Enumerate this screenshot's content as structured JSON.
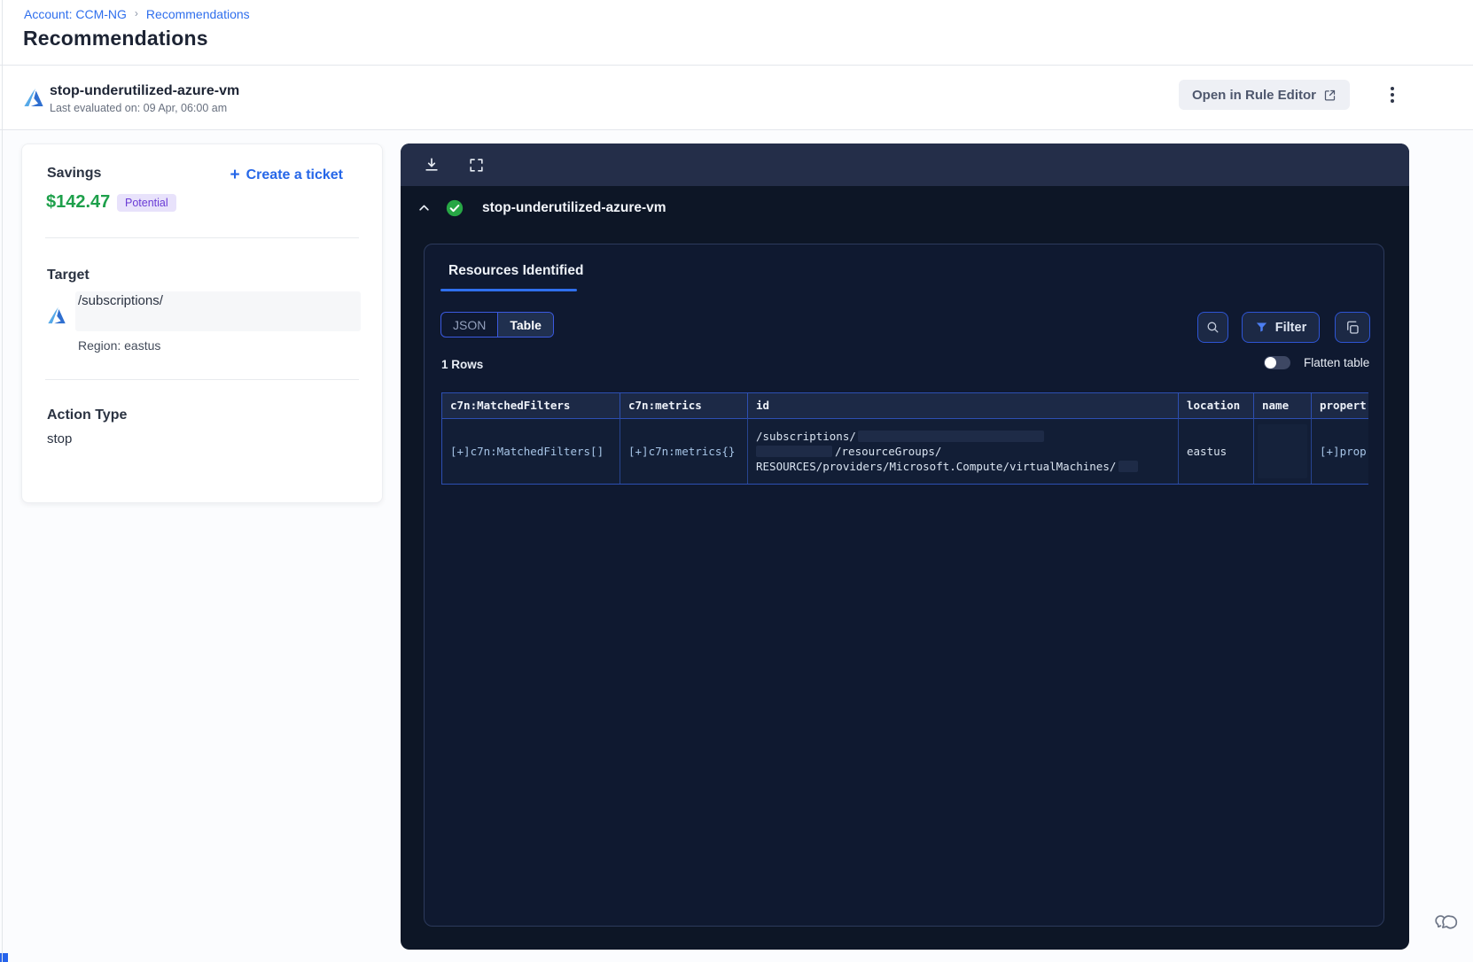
{
  "breadcrumb": {
    "account_link": "Account: CCM-NG",
    "separator": "›",
    "current": "Recommendations"
  },
  "page": {
    "title": "Recommendations"
  },
  "rule_header": {
    "name": "stop-underutilized-azure-vm",
    "last_evaluated": "Last evaluated on: 09 Apr, 06:00 am",
    "open_in_rule_editor": "Open in Rule Editor"
  },
  "savings_card": {
    "savings_label": "Savings",
    "create_ticket_plus": "+",
    "create_ticket_label": "Create a ticket",
    "amount": "$142.47",
    "badge": "Potential",
    "target_label": "Target",
    "target_path": "/subscriptions/",
    "region": "Region: eastus",
    "action_type_label": "Action Type",
    "action_type": "stop"
  },
  "resources_panel": {
    "rule_name": "stop-underutilized-azure-vm",
    "tab_label": "Resources Identified",
    "toggle": {
      "json_label": "JSON",
      "table_label": "Table",
      "active": "Table"
    },
    "filter_label": "Filter",
    "rows_count": "1 Rows",
    "flatten_label": "Flatten table",
    "flatten_state": "off",
    "table": {
      "headers": [
        "c7n:MatchedFilters",
        "c7n:metrics",
        "id",
        "location",
        "name",
        "propert"
      ],
      "row": {
        "matched_filters": "[+]c7n:MatchedFilters[]",
        "metrics": "[+]c7n:metrics{}",
        "id_line1": "/subscriptions/",
        "id_line2": "/resourceGroups/",
        "id_line3": "RESOURCES/providers/Microsoft.Compute/virtualMachines/",
        "location": "eastus",
        "name": "",
        "properties": "[+]prop"
      }
    }
  },
  "colors": {
    "accent_blue": "#2f6fed",
    "savings_green": "#1ea04b",
    "badge_bg": "#e8e2fb",
    "badge_text": "#6a3bd6",
    "panel_bg": "#0d1626",
    "toolbar_bg": "#242e49",
    "table_border_blue": "#2d4fb2",
    "button_border_blue": "#2e55d4",
    "success_green": "#27a745"
  }
}
